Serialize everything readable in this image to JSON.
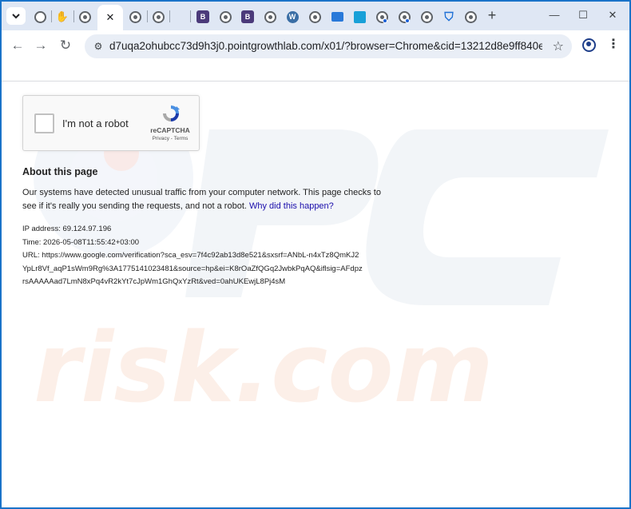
{
  "browser": {
    "tabs": [
      {
        "icon": "camera-search-icon",
        "active": false
      },
      {
        "icon": "hand-icon",
        "active": false
      },
      {
        "icon": "globe-icon",
        "active": false
      },
      {
        "icon": "globe-icon",
        "active": true,
        "close_glyph": "✕"
      },
      {
        "icon": "globe-icon",
        "active": false
      },
      {
        "icon": "globe-icon",
        "active": false
      },
      {
        "icon": "b-logo-icon",
        "active": false,
        "letter": "B"
      },
      {
        "icon": "globe-icon",
        "active": false
      },
      {
        "icon": "b-logo-icon",
        "active": false,
        "letter": "B"
      },
      {
        "icon": "globe-icon",
        "active": false
      },
      {
        "icon": "wordpress-icon",
        "active": false,
        "letter": "W"
      },
      {
        "icon": "globe-icon",
        "active": false
      },
      {
        "icon": "monitor-icon",
        "active": false
      },
      {
        "icon": "grid-icon",
        "active": false
      },
      {
        "icon": "globe-badge-icon",
        "active": false
      },
      {
        "icon": "globe-badge-icon",
        "active": false
      },
      {
        "icon": "globe-icon",
        "active": false
      },
      {
        "icon": "shield-icon",
        "active": false
      },
      {
        "icon": "globe-icon",
        "active": false
      }
    ],
    "new_tab_glyph": "+",
    "window_controls": {
      "minimize": "—",
      "maximize": "☐",
      "close": "✕"
    },
    "nav": {
      "back": "←",
      "forward": "→",
      "reload": "↻"
    },
    "omnibox": {
      "site_info_glyph": "⚙",
      "url": "d7uqa2ohubcc73d9h3j0.pointgrowthlab.com/x01/?browser=Chrome&cid=13212d8e9ff840ee9ae75ce...",
      "star_glyph": "☆"
    },
    "menu_glyph": "⋮",
    "colors": {
      "tabstrip": "#dfe7f4",
      "frame": "#1a73c9",
      "omnibox": "#e9eef6"
    }
  },
  "page": {
    "recaptcha": {
      "label": "I'm not a robot",
      "brand": "reCAPTCHA",
      "links": "Privacy - Terms"
    },
    "about": {
      "title": "About this page",
      "text": "Our systems have detected unusual traffic from your computer network. This page checks to see if it's really you sending the requests, and not a robot.",
      "link": "Why did this happen?"
    },
    "details": {
      "ip": "IP address: 69.124.97.196",
      "time": "Time: 2026-05-08T11:55:42+03:00",
      "url_line1": "URL: https://www.google.com/verification?sca_esv=7f4c92ab13d8e521&sxsrf=ANbL-n4xTz8QmKJ2",
      "url_line2": "YpLr8Vf_aqP1sWm9Rg%3A1775141023481&source=hp&ei=K8rOaZfQGq2JwbkPqAQ&iflsig=AFdpz",
      "url_line3": "rsAAAAAad7LmN8xPq4vR2kYt7cJpWm1GhQxYzRt&ved=0ahUKEwjL8Pj4sM"
    },
    "watermark_text": "risk.com"
  }
}
